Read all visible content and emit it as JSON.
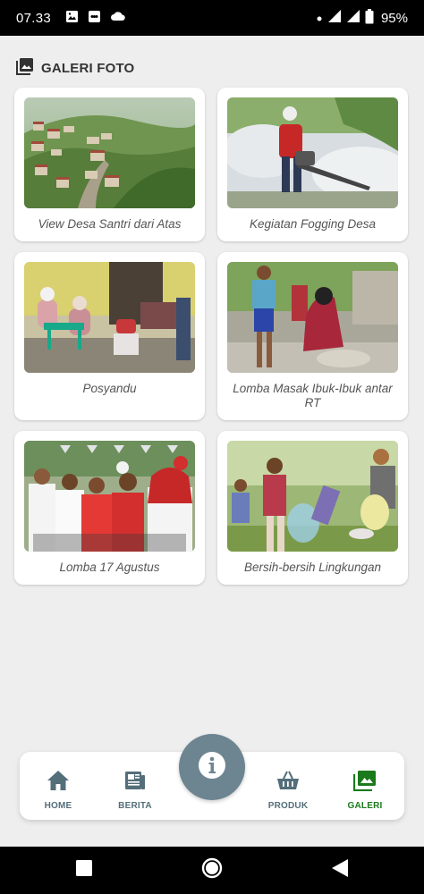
{
  "status_bar": {
    "time": "07.33",
    "battery": "95%",
    "icons": [
      "image-icon",
      "notification-icon",
      "cloud-icon",
      "dot-icon",
      "signal-icon",
      "signal-icon",
      "battery-icon"
    ]
  },
  "section": {
    "icon": "photo-library-icon",
    "title": "GALERI FOTO"
  },
  "gallery": {
    "items": [
      {
        "caption": "View Desa Santri dari Atas"
      },
      {
        "caption": "Kegiatan Fogging Desa"
      },
      {
        "caption": "Posyandu"
      },
      {
        "caption": "Lomba Masak Ibuk-Ibuk antar RT"
      },
      {
        "caption": "Lomba 17 Agustus"
      },
      {
        "caption": "Bersih-bersih Lingkungan"
      }
    ]
  },
  "bottom_nav": {
    "items": [
      {
        "label": "HOME",
        "icon": "home-icon"
      },
      {
        "label": "BERITA",
        "icon": "newspaper-icon"
      },
      {
        "label": "PRODUK",
        "icon": "basket-icon"
      },
      {
        "label": "GALERI",
        "icon": "gallery-icon",
        "active": true
      }
    ],
    "fab_icon": "info-icon"
  },
  "colors": {
    "active": "#1b7a1b",
    "inactive": "#546e7a",
    "fab": "#6d8591",
    "background": "#eeeeee"
  }
}
